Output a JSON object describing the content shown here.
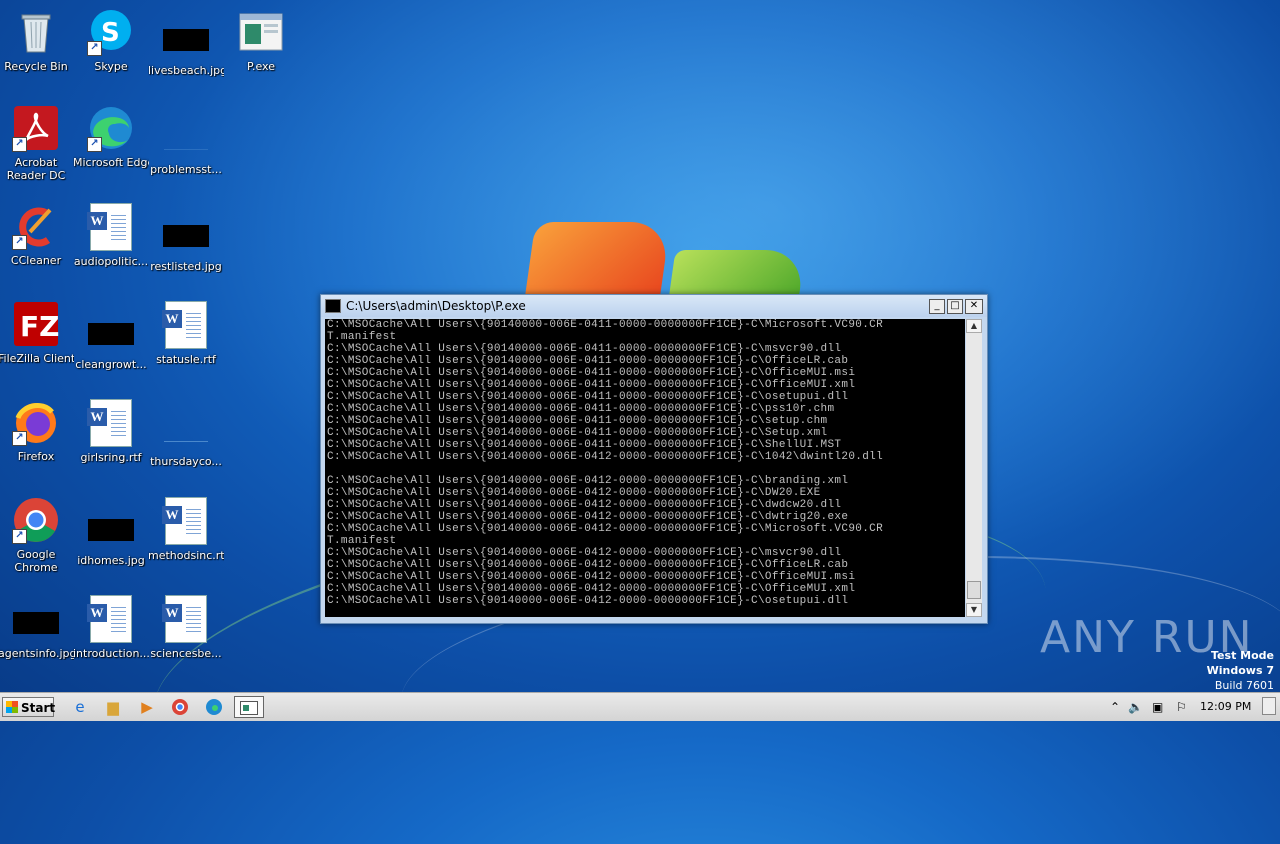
{
  "desktop_icons": [
    {
      "label": "Recycle Bin",
      "icon": "recycle-bin-icon"
    },
    {
      "label": "Skype",
      "icon": "skype-icon"
    },
    {
      "label": "livesbeach.jpg",
      "icon": "image-file-icon"
    },
    {
      "label": "P.exe",
      "icon": "exe-file-icon"
    },
    {
      "label": "Acrobat Reader DC",
      "icon": "acrobat-icon"
    },
    {
      "label": "Microsoft Edge",
      "icon": "edge-icon"
    },
    {
      "label": "problemsst...",
      "icon": "file-icon"
    },
    {
      "label": "CCleaner",
      "icon": "ccleaner-icon"
    },
    {
      "label": "audiopolitic...",
      "icon": "word-doc-icon"
    },
    {
      "label": "restlisted.jpg",
      "icon": "image-file-icon"
    },
    {
      "label": "FileZilla Client",
      "icon": "filezilla-icon"
    },
    {
      "label": "cleangrowt...",
      "icon": "image-file-icon"
    },
    {
      "label": "statusle.rtf",
      "icon": "word-doc-icon"
    },
    {
      "label": "Firefox",
      "icon": "firefox-icon"
    },
    {
      "label": "girlsring.rtf",
      "icon": "word-doc-icon"
    },
    {
      "label": "thursdayco...",
      "icon": "file-icon"
    },
    {
      "label": "Google Chrome",
      "icon": "chrome-icon"
    },
    {
      "label": "idhomes.jpg",
      "icon": "image-file-icon"
    },
    {
      "label": "methodsinc.rtf",
      "icon": "word-doc-icon"
    },
    {
      "label": "agentsinfo.jpg",
      "icon": "image-file-icon"
    },
    {
      "label": "introduction...",
      "icon": "word-doc-icon"
    },
    {
      "label": "sciencesbe...",
      "icon": "word-doc-icon"
    }
  ],
  "console_window": {
    "title": "C:\\Users\\admin\\Desktop\\P.exe",
    "lines": [
      "C:\\MSOCache\\All Users\\{90140000-006E-0411-0000-0000000FF1CE}-C\\Microsoft.VC90.CR",
      "T.manifest",
      "C:\\MSOCache\\All Users\\{90140000-006E-0411-0000-0000000FF1CE}-C\\msvcr90.dll",
      "C:\\MSOCache\\All Users\\{90140000-006E-0411-0000-0000000FF1CE}-C\\OfficeLR.cab",
      "C:\\MSOCache\\All Users\\{90140000-006E-0411-0000-0000000FF1CE}-C\\OfficeMUI.msi",
      "C:\\MSOCache\\All Users\\{90140000-006E-0411-0000-0000000FF1CE}-C\\OfficeMUI.xml",
      "C:\\MSOCache\\All Users\\{90140000-006E-0411-0000-0000000FF1CE}-C\\osetupui.dll",
      "C:\\MSOCache\\All Users\\{90140000-006E-0411-0000-0000000FF1CE}-C\\pss10r.chm",
      "C:\\MSOCache\\All Users\\{90140000-006E-0411-0000-0000000FF1CE}-C\\setup.chm",
      "C:\\MSOCache\\All Users\\{90140000-006E-0411-0000-0000000FF1CE}-C\\Setup.xml",
      "C:\\MSOCache\\All Users\\{90140000-006E-0411-0000-0000000FF1CE}-C\\ShellUI.MST",
      "C:\\MSOCache\\All Users\\{90140000-006E-0412-0000-0000000FF1CE}-C\\1042\\dwintl20.dll",
      "",
      "C:\\MSOCache\\All Users\\{90140000-006E-0412-0000-0000000FF1CE}-C\\branding.xml",
      "C:\\MSOCache\\All Users\\{90140000-006E-0412-0000-0000000FF1CE}-C\\DW20.EXE",
      "C:\\MSOCache\\All Users\\{90140000-006E-0412-0000-0000000FF1CE}-C\\dwdcw20.dll",
      "C:\\MSOCache\\All Users\\{90140000-006E-0412-0000-0000000FF1CE}-C\\dwtrig20.exe",
      "C:\\MSOCache\\All Users\\{90140000-006E-0412-0000-0000000FF1CE}-C\\Microsoft.VC90.CR",
      "T.manifest",
      "C:\\MSOCache\\All Users\\{90140000-006E-0412-0000-0000000FF1CE}-C\\msvcr90.dll",
      "C:\\MSOCache\\All Users\\{90140000-006E-0412-0000-0000000FF1CE}-C\\OfficeLR.cab",
      "C:\\MSOCache\\All Users\\{90140000-006E-0412-0000-0000000FF1CE}-C\\OfficeMUI.msi",
      "C:\\MSOCache\\All Users\\{90140000-006E-0412-0000-0000000FF1CE}-C\\OfficeMUI.xml",
      "C:\\MSOCache\\All Users\\{90140000-006E-0412-0000-0000000FF1CE}-C\\osetupui.dll"
    ]
  },
  "watermark": {
    "brand": "ANY RUN",
    "test_mode": "Test Mode",
    "os": "Windows 7",
    "build": "Build 7601"
  },
  "taskbar": {
    "start_label": "Start",
    "clock": "12:09 PM",
    "pinned": [
      "ie-icon",
      "explorer-icon",
      "media-player-icon",
      "chrome-icon",
      "edge-icon",
      "console-icon"
    ]
  }
}
